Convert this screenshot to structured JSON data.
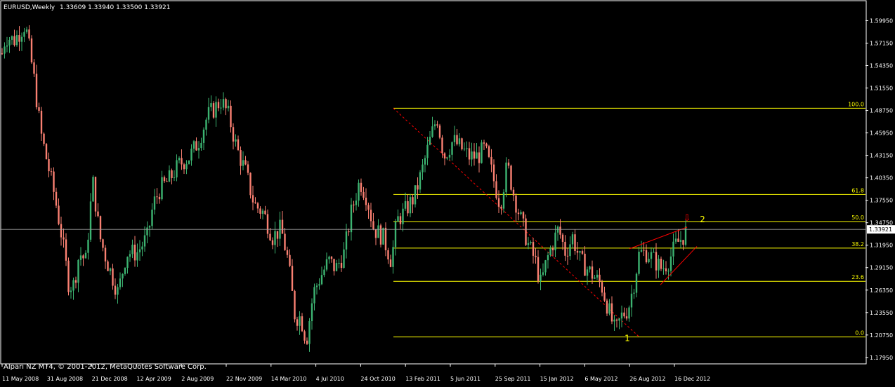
{
  "window": {
    "symbol_title": "EURUSD,Weekly",
    "ohlc_readout": "1.33609 1.33940 1.33500 1.33921",
    "copyright": "Alpari NZ MT4, © 2001-2012, MetaQuotes Software Corp."
  },
  "colors": {
    "background": "#000000",
    "frame": "#ffffff",
    "text": "#ffffff",
    "bull_candle": "#3cb371",
    "bear_candle": "#fa8072",
    "fib_line": "#ffff00",
    "fib_label": "#ffff00",
    "trend_line": "#ff0000",
    "bid_line": "#a0a0a0",
    "wave_label": "#ffff00"
  },
  "chart_data": {
    "type": "candlestick",
    "title": "EURUSD,Weekly",
    "ylim": [
      1.175,
      1.62
    ],
    "grid": false,
    "y_ticks": [
      "1.59950",
      "1.57150",
      "1.54350",
      "1.51550",
      "1.48750",
      "1.45950",
      "1.43150",
      "1.40350",
      "1.37550",
      "1.34750",
      "1.31950",
      "1.29150",
      "1.26350",
      "1.23550",
      "1.20750",
      "1.17950"
    ],
    "x_ticks": [
      "11 May 2008",
      "31 Aug 2008",
      "21 Dec 2008",
      "12 Apr 2009",
      "2 Aug 2009",
      "22 Nov 2009",
      "14 Mar 2010",
      "4 Jul 2010",
      "24 Oct 2010",
      "13 Feb 2011",
      "5 Jun 2011",
      "25 Sep 2011",
      "15 Jan 2012",
      "6 May 2012",
      "26 Aug 2012",
      "16 Dec 2012"
    ],
    "current_price": "1.33921",
    "price_path": [
      [
        1,
        1.55
      ],
      [
        8,
        1.58
      ],
      [
        20,
        1.575
      ],
      [
        36,
        1.595
      ],
      [
        48,
        1.53
      ],
      [
        58,
        1.46
      ],
      [
        68,
        1.42
      ],
      [
        78,
        1.38
      ],
      [
        88,
        1.33
      ],
      [
        98,
        1.27
      ],
      [
        105,
        1.27
      ],
      [
        113,
        1.31
      ],
      [
        122,
        1.3
      ],
      [
        132,
        1.4
      ],
      [
        142,
        1.33
      ],
      [
        152,
        1.3
      ],
      [
        168,
        1.26
      ],
      [
        180,
        1.31
      ],
      [
        195,
        1.31
      ],
      [
        210,
        1.33
      ],
      [
        218,
        1.37
      ],
      [
        228,
        1.39
      ],
      [
        240,
        1.4
      ],
      [
        255,
        1.42
      ],
      [
        270,
        1.43
      ],
      [
        283,
        1.45
      ],
      [
        295,
        1.48
      ],
      [
        305,
        1.49
      ],
      [
        315,
        1.5
      ],
      [
        326,
        1.48
      ],
      [
        337,
        1.44
      ],
      [
        350,
        1.41
      ],
      [
        362,
        1.37
      ],
      [
        375,
        1.36
      ],
      [
        388,
        1.33
      ],
      [
        400,
        1.34
      ],
      [
        410,
        1.3
      ],
      [
        420,
        1.23
      ],
      [
        428,
        1.23
      ],
      [
        436,
        1.2
      ],
      [
        446,
        1.26
      ],
      [
        456,
        1.28
      ],
      [
        468,
        1.3
      ],
      [
        478,
        1.29
      ],
      [
        490,
        1.31
      ],
      [
        500,
        1.36
      ],
      [
        512,
        1.4
      ],
      [
        522,
        1.38
      ],
      [
        532,
        1.34
      ],
      [
        545,
        1.33
      ],
      [
        557,
        1.3
      ],
      [
        565,
        1.35
      ],
      [
        575,
        1.36
      ],
      [
        590,
        1.38
      ],
      [
        600,
        1.41
      ],
      [
        612,
        1.45
      ],
      [
        622,
        1.48
      ],
      [
        632,
        1.43
      ],
      [
        645,
        1.45
      ],
      [
        657,
        1.44
      ],
      [
        668,
        1.43
      ],
      [
        680,
        1.43
      ],
      [
        690,
        1.44
      ],
      [
        700,
        1.41
      ],
      [
        712,
        1.37
      ],
      [
        722,
        1.42
      ],
      [
        732,
        1.38
      ],
      [
        742,
        1.35
      ],
      [
        752,
        1.32
      ],
      [
        762,
        1.3
      ],
      [
        770,
        1.27
      ],
      [
        778,
        1.3
      ],
      [
        786,
        1.32
      ],
      [
        795,
        1.34
      ],
      [
        805,
        1.31
      ],
      [
        815,
        1.33
      ],
      [
        826,
        1.3
      ],
      [
        836,
        1.29
      ],
      [
        846,
        1.28
      ],
      [
        856,
        1.27
      ],
      [
        866,
        1.24
      ],
      [
        876,
        1.21
      ],
      [
        884,
        1.23
      ],
      [
        894,
        1.24
      ],
      [
        902,
        1.27
      ],
      [
        910,
        1.31
      ],
      [
        922,
        1.31
      ],
      [
        932,
        1.3
      ],
      [
        942,
        1.29
      ],
      [
        952,
        1.3
      ],
      [
        962,
        1.32
      ],
      [
        972,
        1.33
      ],
      [
        978,
        1.339
      ]
    ],
    "fibonacci_levels": [
      {
        "label": "100.0",
        "value": 1.4903
      },
      {
        "label": "61.8",
        "value": 1.3827
      },
      {
        "label": "50.0",
        "value": 1.349
      },
      {
        "label": "38.2",
        "value": 1.3159
      },
      {
        "label": "23.6",
        "value": 1.2745
      },
      {
        "label": "0.0",
        "value": 1.205
      }
    ],
    "fib_x_range": [
      560,
      1232
    ],
    "fib_anchor": {
      "from": {
        "x": 560,
        "y": 1.4903
      },
      "to": {
        "x": 910,
        "y": 1.205
      }
    },
    "trend_lines": [
      {
        "from": {
          "x": 896,
          "y": 1.315
        },
        "to": {
          "x": 978,
          "y": 1.342
        }
      },
      {
        "from": {
          "x": 940,
          "y": 1.27
        },
        "to": {
          "x": 992,
          "y": 1.318
        }
      }
    ],
    "annotations": [
      {
        "text": "2",
        "x": 1000,
        "y": 1.348
      },
      {
        "text": "1",
        "x": 893,
        "y": 1.2
      },
      {
        "text": "⇩",
        "x": 978,
        "y": 1.35
      }
    ]
  }
}
